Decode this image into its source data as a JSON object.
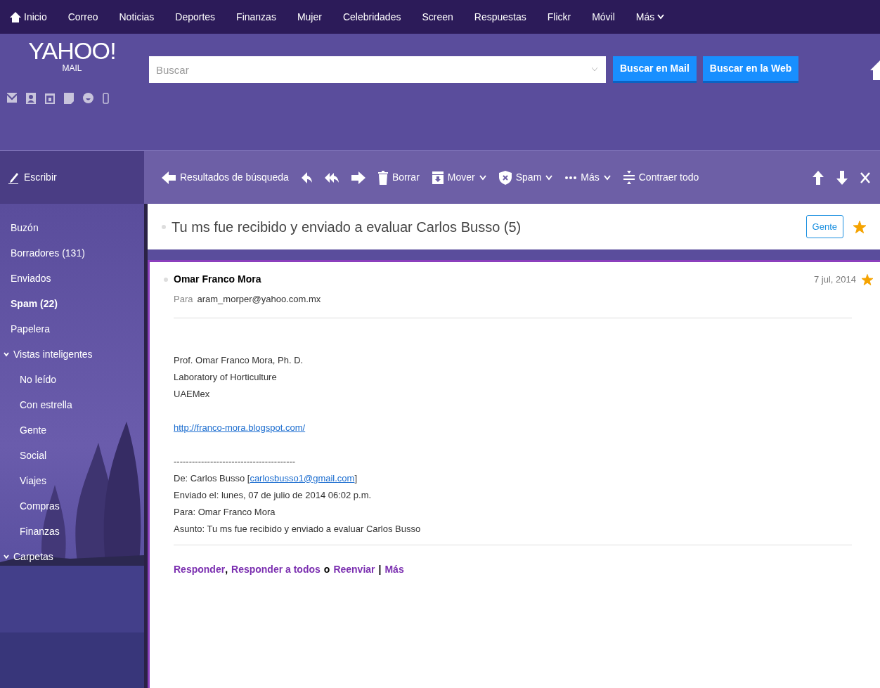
{
  "top_nav": [
    {
      "label": "Inicio",
      "kind": "home"
    },
    {
      "label": "Correo",
      "kind": "link"
    },
    {
      "label": "Noticias",
      "kind": "link"
    },
    {
      "label": "Deportes",
      "kind": "link"
    },
    {
      "label": "Finanzas",
      "kind": "link"
    },
    {
      "label": "Mujer",
      "kind": "link"
    },
    {
      "label": "Celebridades",
      "kind": "link"
    },
    {
      "label": "Screen",
      "kind": "link"
    },
    {
      "label": "Respuestas",
      "kind": "link"
    },
    {
      "label": "Flickr",
      "kind": "link"
    },
    {
      "label": "Móvil",
      "kind": "link"
    },
    {
      "label": "Más",
      "kind": "menu"
    }
  ],
  "logo": {
    "brand": "YAHOO!",
    "product": "MAIL"
  },
  "search": {
    "placeholder": "Buscar",
    "buttons": [
      "Buscar en Mail",
      "Buscar en la Web"
    ]
  },
  "compose": {
    "label": "Escribir"
  },
  "toolbar": [
    {
      "kind": "back",
      "label": "Resultados de búsqueda",
      "dropdown": false
    },
    {
      "kind": "reply",
      "dropdown": false
    },
    {
      "kind": "reply-all",
      "dropdown": false
    },
    {
      "kind": "forward",
      "dropdown": false
    },
    {
      "kind": "trash",
      "label": "Borrar",
      "dropdown": false
    },
    {
      "kind": "move",
      "label": "Mover",
      "dropdown": true
    },
    {
      "kind": "spam",
      "label": "Spam",
      "dropdown": true
    },
    {
      "kind": "dots",
      "label": "Más",
      "dropdown": true
    },
    {
      "kind": "collapse",
      "label": "Contraer todo",
      "dropdown": false
    }
  ],
  "toolbar_right": [
    {
      "kind": "up"
    },
    {
      "kind": "down"
    },
    {
      "kind": "close"
    }
  ],
  "sidebar": {
    "items": [
      {
        "label": "Buzón",
        "unread": false
      },
      {
        "label": "Borradores (131)",
        "unread": false
      },
      {
        "label": "Enviados",
        "unread": false
      },
      {
        "label": "Spam (22)",
        "unread": true
      },
      {
        "label": "Papelera",
        "unread": false
      },
      {
        "label": "Vistas inteligentes",
        "unread": false,
        "expanded": true,
        "children": [
          {
            "label": "No leído",
            "unread": false
          },
          {
            "label": "Con estrella",
            "unread": false
          },
          {
            "label": "Gente",
            "unread": false
          },
          {
            "label": "Social",
            "unread": false
          },
          {
            "label": "Viajes",
            "unread": false
          },
          {
            "label": "Compras",
            "unread": false
          },
          {
            "label": "Finanzas",
            "unread": false
          }
        ]
      },
      {
        "label": "Carpetas",
        "unread": false,
        "expanded": true
      }
    ]
  },
  "conversation": {
    "subject": "Tu ms fue recibido y enviado a evaluar Carlos Busso (5)",
    "people_button": "Gente",
    "starred": true
  },
  "message": {
    "sender": "Omar Franco Mora",
    "date": "7 jul, 2014",
    "starred": true,
    "to_label": "Para",
    "to": "aram_morper@yahoo.com.mx",
    "body": [
      {
        "kind": "text",
        "text": "Prof. Omar Franco Mora, Ph. D."
      },
      {
        "kind": "text",
        "text": "Laboratory of Horticulture"
      },
      {
        "kind": "text",
        "text": "UAEMex"
      },
      {
        "kind": "gap"
      },
      {
        "kind": "link",
        "text": "http://franco-mora.blogspot.com/"
      },
      {
        "kind": "gap"
      },
      {
        "kind": "text",
        "text": "----------------------------------------"
      },
      {
        "kind": "link_line",
        "prefix": "De: Carlos Busso [",
        "link": "carlosbusso1@gmail.com",
        "suffix": "]"
      },
      {
        "kind": "text",
        "text": "Enviado el: lunes, 07 de julio de 2014 06:02 p.m."
      },
      {
        "kind": "text",
        "text": "Para: Omar Franco Mora"
      },
      {
        "kind": "text",
        "text": "Asunto: Tu ms fue recibido y enviado a evaluar Carlos Busso"
      }
    ],
    "actions": [
      {
        "kind": "link",
        "text": "Responder"
      },
      {
        "kind": "comma",
        "text": ","
      },
      {
        "kind": "link",
        "text": "Responder a todos"
      },
      {
        "kind": "word",
        "text": "o"
      },
      {
        "kind": "link",
        "text": "Reenviar"
      },
      {
        "kind": "word",
        "text": "|"
      },
      {
        "kind": "link",
        "text": "Más"
      }
    ]
  }
}
